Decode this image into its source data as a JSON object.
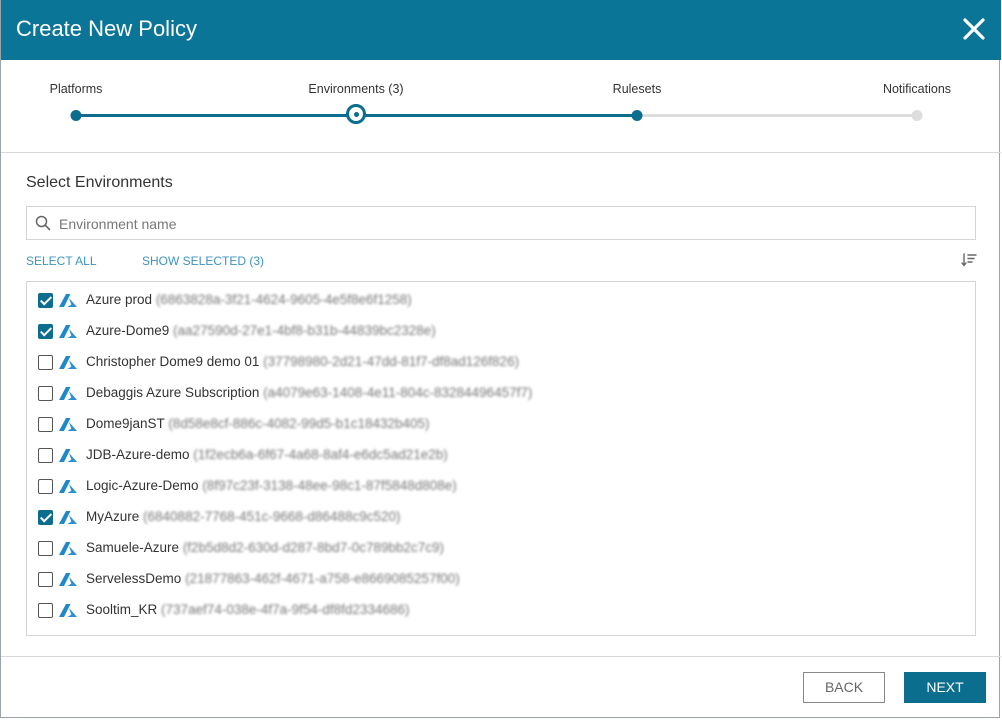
{
  "dialog": {
    "title": "Create New Policy"
  },
  "stepper": {
    "steps": [
      {
        "label": "Platforms",
        "state": "done"
      },
      {
        "label": "Environments (3)",
        "state": "current"
      },
      {
        "label": "Rulesets",
        "state": "done"
      },
      {
        "label": "Notifications",
        "state": "pending"
      }
    ],
    "colors": {
      "active": "#0b6e8e",
      "inactive": "#dddddd"
    }
  },
  "environments": {
    "title": "Select Environments",
    "search_placeholder": "Environment name",
    "search_value": "",
    "select_all": "SELECT ALL",
    "show_selected": "SHOW SELECTED (3)",
    "items": [
      {
        "name": "Azure prod",
        "id": "(6863828a-3f21-4624-9605-4e5f8e6f1258)",
        "checked": true
      },
      {
        "name": "Azure-Dome9",
        "id": "(aa27590d-27e1-4bf8-b31b-44839bc2328e)",
        "checked": true
      },
      {
        "name": "Christopher Dome9 demo 01",
        "id": "(37798980-2d21-47dd-81f7-df8ad126f826)",
        "checked": false
      },
      {
        "name": "Debaggis Azure Subscription",
        "id": "(a4079e63-1408-4e11-804c-83284496457f7)",
        "checked": false
      },
      {
        "name": "Dome9janST",
        "id": "(8d58e8cf-886c-4082-99d5-b1c18432b405)",
        "checked": false
      },
      {
        "name": "JDB-Azure-demo",
        "id": "(1f2ecb6a-6f67-4a68-8af4-e6dc5ad21e2b)",
        "checked": false
      },
      {
        "name": "Logic-Azure-Demo",
        "id": "(8f97c23f-3138-48ee-98c1-87f5848d808e)",
        "checked": false
      },
      {
        "name": "MyAzure",
        "id": "(6840882-7768-451c-9668-d86488c9c520)",
        "checked": true
      },
      {
        "name": "Samuele-Azure",
        "id": "(f2b5d8d2-630d-d287-8bd7-0c789bb2c7c9)",
        "checked": false
      },
      {
        "name": "ServelessDemo",
        "id": "(21877863-462f-4671-a758-e8669085257f00)",
        "checked": false
      },
      {
        "name": "Sooltim_KR",
        "id": "(737aef74-038e-4f7a-9f54-df8fd2334686)",
        "checked": false
      }
    ]
  },
  "footer": {
    "back_label": "BACK",
    "next_label": "NEXT"
  }
}
